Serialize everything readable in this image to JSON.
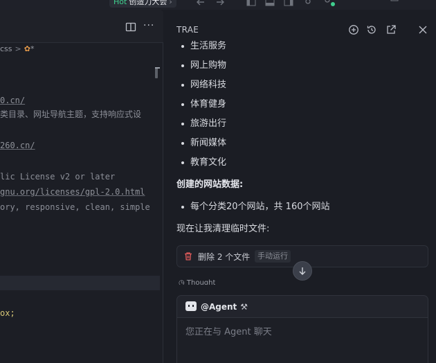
{
  "titlebar": {
    "hot_label": "Hot",
    "project_name": "创造力大会",
    "chevron": "›"
  },
  "editor": {
    "breadcrumb": {
      "file_part": "css",
      "separator": ">",
      "asterisk": "*"
    },
    "code_lines": [
      "0.cn/",
      "类目录、网址导航主题，支持响应式设",
      "260.cn/",
      "lic License v2 or later",
      "gnu.org/licenses/gpl-2.0.html",
      "ory, responsive, clean, simple",
      "ox;"
    ]
  },
  "chat": {
    "title": "TRAE",
    "bullets_top": [
      "生活服务",
      "网上购物",
      "网络科技",
      "体育健身",
      "旅游出行",
      "新闻媒体",
      "教育文化"
    ],
    "created_heading": "创建的网站数据:",
    "created_bullet": "每个分类20个网站，共 160个网站",
    "cleanup_text": "现在让我清理临时文件:",
    "tool": {
      "label": "删除 2 个文件",
      "tag": "手动运行"
    },
    "thought_label": "Thought",
    "input": {
      "agent_label": "@Agent",
      "placeholder": "您正在与 Agent 聊天"
    }
  },
  "colors": {
    "accent_green": "#3fcf8e",
    "trash_red": "#e25b5b",
    "panel_bg": "#1b1d24"
  }
}
